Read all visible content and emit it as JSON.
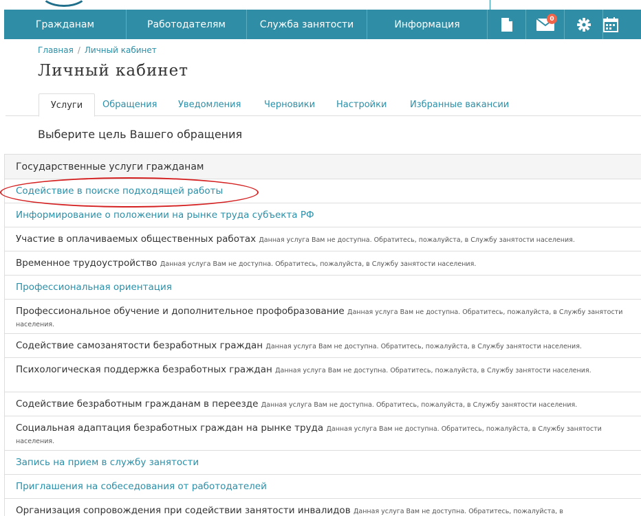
{
  "nav": {
    "items": [
      "Гражданам",
      "Работодателям",
      "Служба занятости",
      "Информация"
    ],
    "mail_badge": "0"
  },
  "breadcrumb": {
    "home": "Главная",
    "separator": "/",
    "current": "Личный кабинет"
  },
  "page_title": "Личный кабинет",
  "tabs": [
    "Услуги",
    "Обращения",
    "Уведомления",
    "Черновики",
    "Настройки",
    "Избранные вакансии"
  ],
  "subtitle": "Выберите цель Вашего обращения",
  "panel": {
    "title": "Государственные услуги гражданам",
    "services": [
      {
        "name": "Содействие в поиске подходящей работы",
        "note": "",
        "available": true
      },
      {
        "name": "Информирование о положении на рынке труда субъекта РФ",
        "note": "",
        "available": true
      },
      {
        "name": "Участие в оплачиваемых общественных работах",
        "note": "Данная услуга Вам не доступна. Обратитесь, пожалуйста, в Службу занятости населения.",
        "available": false
      },
      {
        "name": "Временное трудоустройство",
        "note": "Данная услуга Вам не доступна. Обратитесь, пожалуйста, в Службу занятости населения.",
        "available": false
      },
      {
        "name": "Профессиональная ориентация",
        "note": "",
        "available": true
      },
      {
        "name": "Профессиональное обучение и дополнительное профобразование",
        "note": "Данная услуга Вам не доступна. Обратитесь, пожалуйста, в Службу занятости населения.",
        "available": false
      },
      {
        "name": "Содействие самозанятости безработных граждан",
        "note": "Данная услуга Вам не доступна. Обратитесь, пожалуйста, в Службу занятости населения.",
        "available": false
      },
      {
        "name": "Психологическая поддержка безработных граждан",
        "note": "Данная услуга Вам не доступна. Обратитесь, пожалуйста, в Службу занятости населения.",
        "available": false
      },
      {
        "name": "Содействие безработным гражданам в переезде",
        "note": "Данная услуга Вам не доступна. Обратитесь, пожалуйста, в Службу занятости населения.",
        "available": false
      },
      {
        "name": "Социальная адаптация безработных граждан на рынке труда",
        "note": "Данная услуга Вам не доступна. Обратитесь, пожалуйста, в Службу занятости населения.",
        "available": false
      },
      {
        "name": "Запись на прием в службу занятости",
        "note": "",
        "available": true
      },
      {
        "name": "Приглашения на собеседования от работодателей",
        "note": "",
        "available": true
      },
      {
        "name": "Организация сопровождения при содействии занятости инвалидов",
        "note": "Данная услуга Вам не доступна. Обратитесь, пожалуйста, в",
        "available": false
      }
    ]
  },
  "colors": {
    "nav_bg": "#2f8ea6",
    "link": "#2a8fa8",
    "badge": "#f0644a",
    "highlight_oval": "#d42020"
  }
}
